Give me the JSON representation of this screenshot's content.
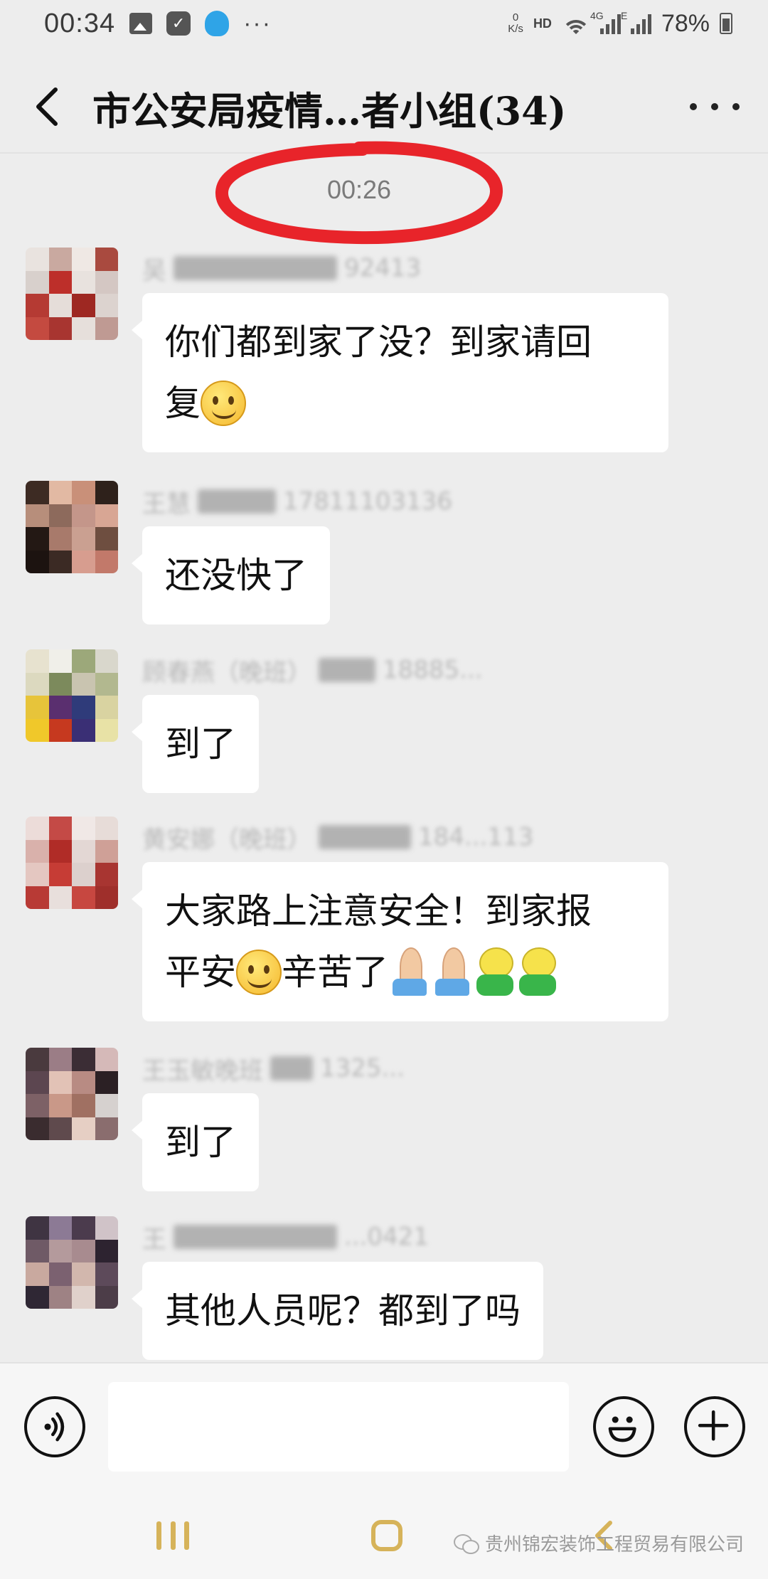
{
  "status_bar": {
    "time": "00:34",
    "icons": [
      "image-icon",
      "check-icon",
      "qq-icon"
    ],
    "more": "···",
    "speed_value": "0",
    "speed_unit": "K/s",
    "hd": "HD",
    "network_1": "4G",
    "network_2": "E",
    "battery": "78%"
  },
  "header": {
    "title": "市公安局疫情…者小组(34)",
    "back_icon": "chevron-left-icon",
    "more_icon": "more-icon"
  },
  "timestamp": "00:26",
  "messages": [
    {
      "sender": "吴",
      "sender_suffix": "92413",
      "text_parts": [
        "你们都到家了没？到家请回",
        "复"
      ],
      "emojis": [
        "smile"
      ],
      "avatar_colors": [
        "#e9e3df",
        "#c9a9a0",
        "#efe8e4",
        "#a94a3f",
        "#d8d0cc",
        "#bd2f2a",
        "#e8e2de",
        "#d4c7c3",
        "#b53a33",
        "#e5ddd9",
        "#9e2822",
        "#dcd3cf",
        "#c44a40",
        "#a83530",
        "#e6dfdb",
        "#bf9a93"
      ]
    },
    {
      "sender": "王慧",
      "sender_suffix": "17811103136",
      "text": "还没快了",
      "avatar_colors": [
        "#3d2b23",
        "#e2b9a3",
        "#c99079",
        "#2e211b",
        "#b78e7b",
        "#8d6a5c",
        "#c4968a",
        "#d8a694",
        "#231814",
        "#a87a6b",
        "#caa091",
        "#6e4e40",
        "#1c1310",
        "#3b2a24",
        "#d79d8f",
        "#c2796a"
      ]
    },
    {
      "sender": "顾春燕（晚班）",
      "sender_suffix": "18885...",
      "text": "到了",
      "avatar_colors": [
        "#e7e2cf",
        "#f0efe9",
        "#9ca87a",
        "#d9d7cc",
        "#dcd9bf",
        "#7c8a5c",
        "#c9c4b0",
        "#b2b88f",
        "#e7c43a",
        "#5a2f6f",
        "#2f3b7a",
        "#d9d3a1",
        "#f0c82a",
        "#c6391f",
        "#3a2f75",
        "#e8e2a6"
      ]
    },
    {
      "sender": "黄安娜（晚班）",
      "sender_suffix": "184...113",
      "text_parts": [
        "大家路上注意安全！到家报",
        "平安",
        "辛苦了"
      ],
      "emojis": [
        "smile",
        "pray",
        "pray",
        "frog",
        "frog"
      ],
      "avatar_colors": [
        "#ecdcd9",
        "#c44a46",
        "#f0e8e6",
        "#e7dcd8",
        "#d9b1ab",
        "#b02c27",
        "#e3d7d4",
        "#cfa097",
        "#e4c7c1",
        "#c63c35",
        "#dcd0cd",
        "#a83531",
        "#b83a35",
        "#e8dfdc",
        "#c74740",
        "#9f2f2b"
      ]
    },
    {
      "sender": "王玉敏晚班",
      "sender_suffix": "1325...",
      "text": "到了",
      "avatar_colors": [
        "#4a3a3e",
        "#9b7d86",
        "#3b2d35",
        "#d5b9b8",
        "#5c4650",
        "#e2c2b6",
        "#b88b83",
        "#2b2024",
        "#7d6166",
        "#c99888",
        "#a07062",
        "#d6d1cf",
        "#3a2c2f",
        "#5f4a4d",
        "#e6cfc4",
        "#8a6d6e"
      ]
    },
    {
      "sender": "王",
      "sender_suffix": "...0421",
      "text": "其他人员呢？都到了吗",
      "avatar_colors": [
        "#3f3442",
        "#8c7a95",
        "#4b3b4d",
        "#d0c3c8",
        "#6f5a66",
        "#b49a9c",
        "#a88b8f",
        "#2d2330",
        "#c9a99f",
        "#7b6170",
        "#d2b7ad",
        "#5d4a5a",
        "#2f2734",
        "#9e8284",
        "#e0d1cb",
        "#4c3d48"
      ]
    }
  ],
  "input_bar": {
    "voice_icon": "voice-icon",
    "input_value": "",
    "emoji_icon": "emoji-icon",
    "plus_icon": "plus-icon"
  },
  "nav_bar": {
    "recent_icon": "recent-apps-icon",
    "home_icon": "home-icon",
    "back_icon": "back-icon"
  },
  "watermark": "贵州锦宏装饰工程贸易有限公司",
  "colors": {
    "background": "#ededed",
    "bubble": "#ffffff",
    "highlight_circle": "#e8242a",
    "nav_accent": "#d6b35a"
  }
}
